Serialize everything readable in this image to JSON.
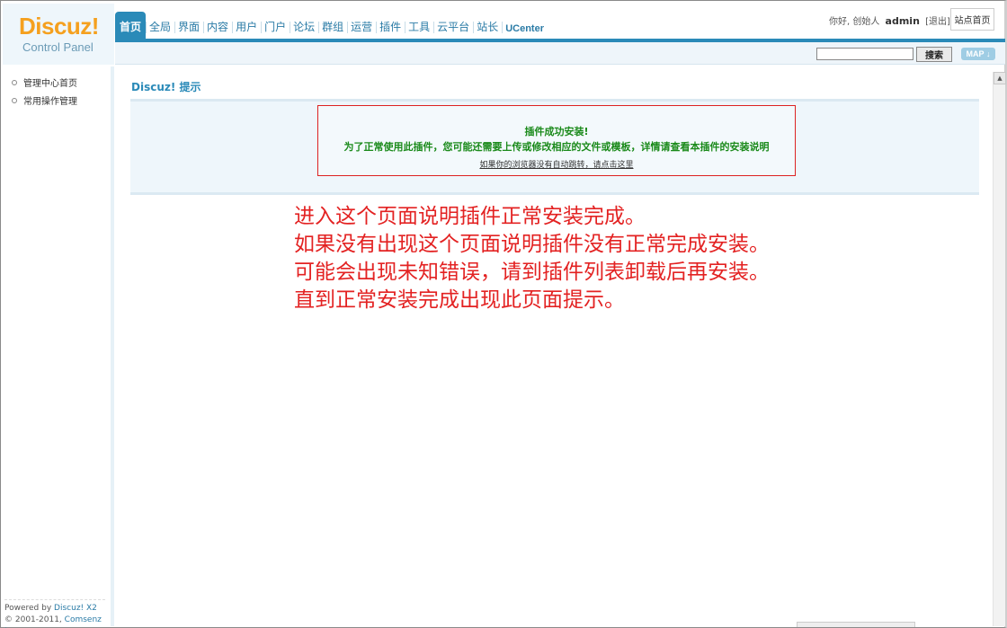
{
  "logo": {
    "text": "Discuz!",
    "subtitle": "Control Panel"
  },
  "nav": {
    "items": [
      "首页",
      "全局",
      "界面",
      "内容",
      "用户",
      "门户",
      "论坛",
      "群组",
      "运营",
      "插件",
      "工具",
      "云平台",
      "站长",
      "UCenter"
    ],
    "active_index": 0
  },
  "user": {
    "greeting": "你好, 创始人",
    "name": "admin",
    "logout": "[退出]",
    "site_home": "站点首页"
  },
  "search": {
    "button": "搜索",
    "map": "MAP"
  },
  "sidebar": {
    "items": [
      {
        "label": "管理中心首页"
      },
      {
        "label": "常用操作管理"
      }
    ]
  },
  "footer": {
    "powered_prefix": "Powered by",
    "powered_link": "Discuz! X2",
    "copyright_prefix": "© 2001-2011,",
    "copyright_link": "Comsenz Inc."
  },
  "content": {
    "title": "Discuz! 提示",
    "notice_title": "插件成功安装!",
    "notice_text": "为了正常使用此插件，您可能还需要上传或修改相应的文件或模板，详情请查看本插件的安装说明",
    "notice_link": "如果你的浏览器没有自动跳转，请点击这里"
  },
  "annotation": {
    "lines": [
      "进入这个页面说明插件正常安装完成。",
      "如果没有出现这个页面说明插件没有正常完成安装。",
      "可能会出现未知错误，请到插件列表卸载后再安装。",
      "直到正常安装完成出现此页面提示。"
    ]
  },
  "colors": {
    "accent": "#2a8ab8",
    "logo": "#f5a01e",
    "annotation": "#e32222",
    "success": "#1a8a1a"
  }
}
